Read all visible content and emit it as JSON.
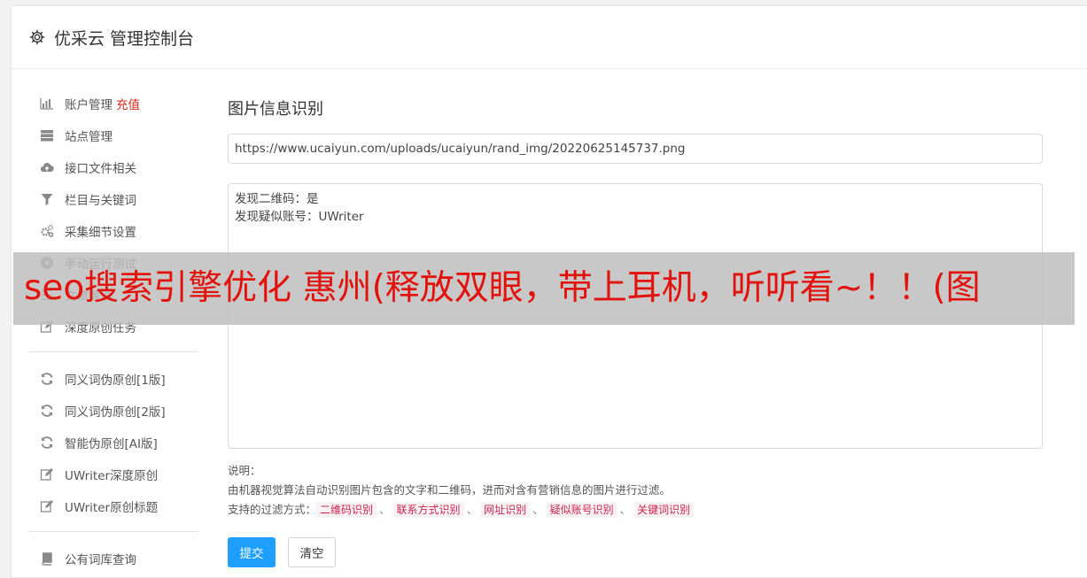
{
  "header": {
    "title": "优采云 管理控制台"
  },
  "sidebar": {
    "group1": [
      {
        "label": "账户管理",
        "extra": "充值",
        "icon": "bar-chart-icon"
      },
      {
        "label": "站点管理",
        "icon": "server-icon"
      },
      {
        "label": "接口文件相关",
        "icon": "cloud-upload-icon"
      },
      {
        "label": "栏目与关键词",
        "icon": "filter-icon"
      },
      {
        "label": "采集细节设置",
        "icon": "gears-icon"
      },
      {
        "label": "手动运行测试",
        "icon": "play-circle-icon"
      },
      {
        "label": "文章管理",
        "icon": "list-icon"
      },
      {
        "label": "深度原创任务",
        "icon": "edit-icon"
      }
    ],
    "group2": [
      {
        "label": "同义词伪原创[1版]",
        "icon": "refresh-icon"
      },
      {
        "label": "同义词伪原创[2版]",
        "icon": "refresh-icon"
      },
      {
        "label": "智能伪原创[AI版]",
        "icon": "refresh-icon"
      },
      {
        "label": "UWriter深度原创",
        "icon": "edit-icon"
      },
      {
        "label": "UWriter原创标题",
        "icon": "edit-icon"
      }
    ],
    "group3": [
      {
        "label": "公有词库查询",
        "icon": "book-icon"
      }
    ]
  },
  "main": {
    "section_title": "图片信息识别",
    "url_value": "https://www.ucaiyun.com/uploads/ucaiyun/rand_img/20220625145737.png",
    "result_lines": [
      "发现二维码：是",
      "发现疑似账号：UWriter"
    ],
    "notes_label": "说明：",
    "notes_desc": "由机器视觉算法自动识别图片包含的文字和二维码，进而对含有营销信息的图片进行过滤。",
    "filter_label": "支持的过滤方式：",
    "filter_tags": [
      "二维码识别",
      "联系方式识别",
      "网址识别",
      "疑似账号识别",
      "关键词识别"
    ],
    "separator": "、",
    "submit_label": "提交",
    "clear_label": "清空"
  },
  "overlay": {
    "text": "seo搜索引擎优化 惠州(释放双眼，带上耳机，听听看~！！(图"
  },
  "colors": {
    "accent": "#1e9fff",
    "recharge": "#d9261c",
    "tag_text": "#c7254e",
    "overlay_text": "#e3110b"
  }
}
